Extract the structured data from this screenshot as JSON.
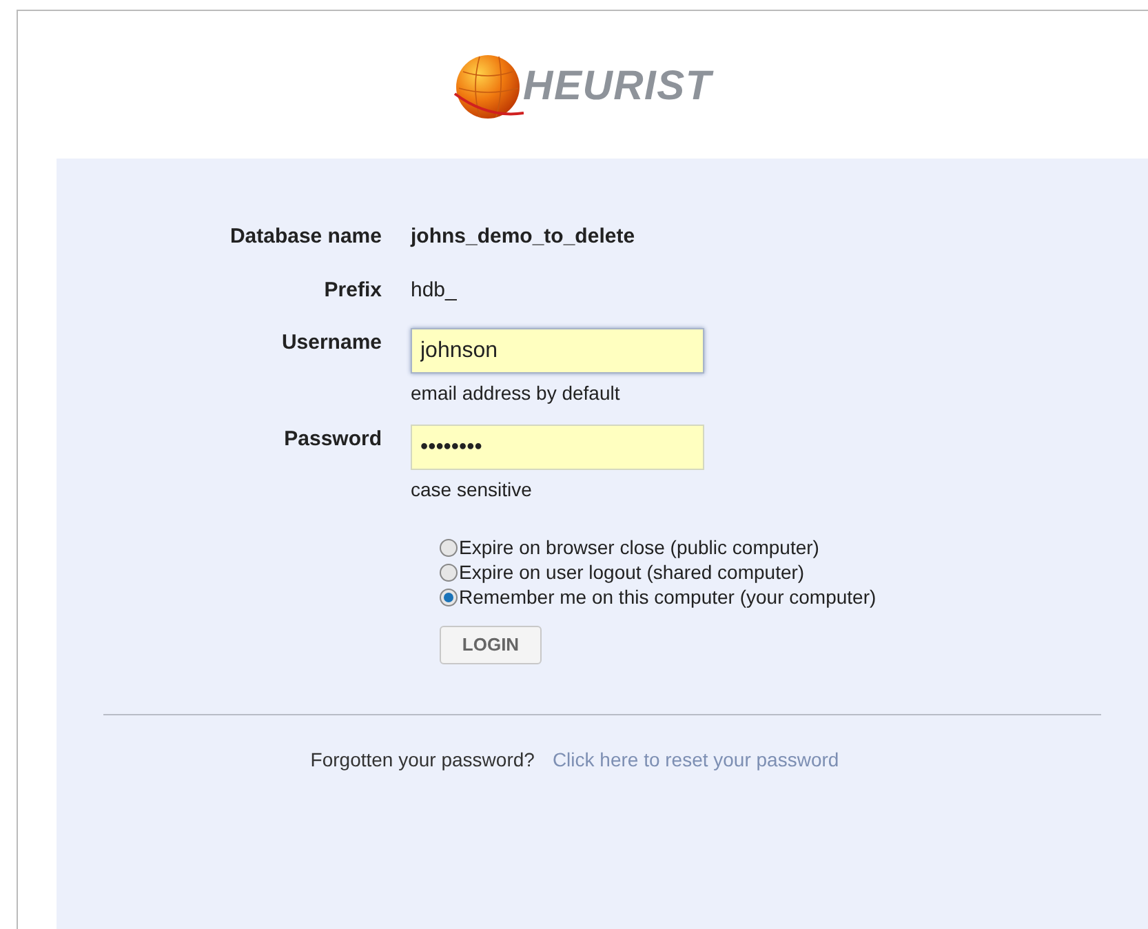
{
  "logo": {
    "text": "HEURIST"
  },
  "fields": [
    {
      "kind": "static",
      "label": "Database name",
      "value": "johns_demo_to_delete",
      "bold": true
    },
    {
      "kind": "static",
      "label": "Prefix",
      "value": "hdb_",
      "bold": false
    },
    {
      "kind": "input",
      "label": "Username",
      "value": "johnson",
      "hint": "email address by default",
      "focused": true
    },
    {
      "kind": "input",
      "label": "Password",
      "value": "••••••••",
      "hint": "case sensitive",
      "focused": false
    }
  ],
  "session_options": [
    {
      "label": "Expire on browser close (public computer)",
      "selected": false
    },
    {
      "label": "Expire on user logout (shared computer)",
      "selected": false
    },
    {
      "label": "Remember me on this computer (your computer)",
      "selected": true
    }
  ],
  "login_button": "LOGIN",
  "footer": {
    "text": "Forgotten your password?",
    "link": "Click here to reset your password"
  }
}
